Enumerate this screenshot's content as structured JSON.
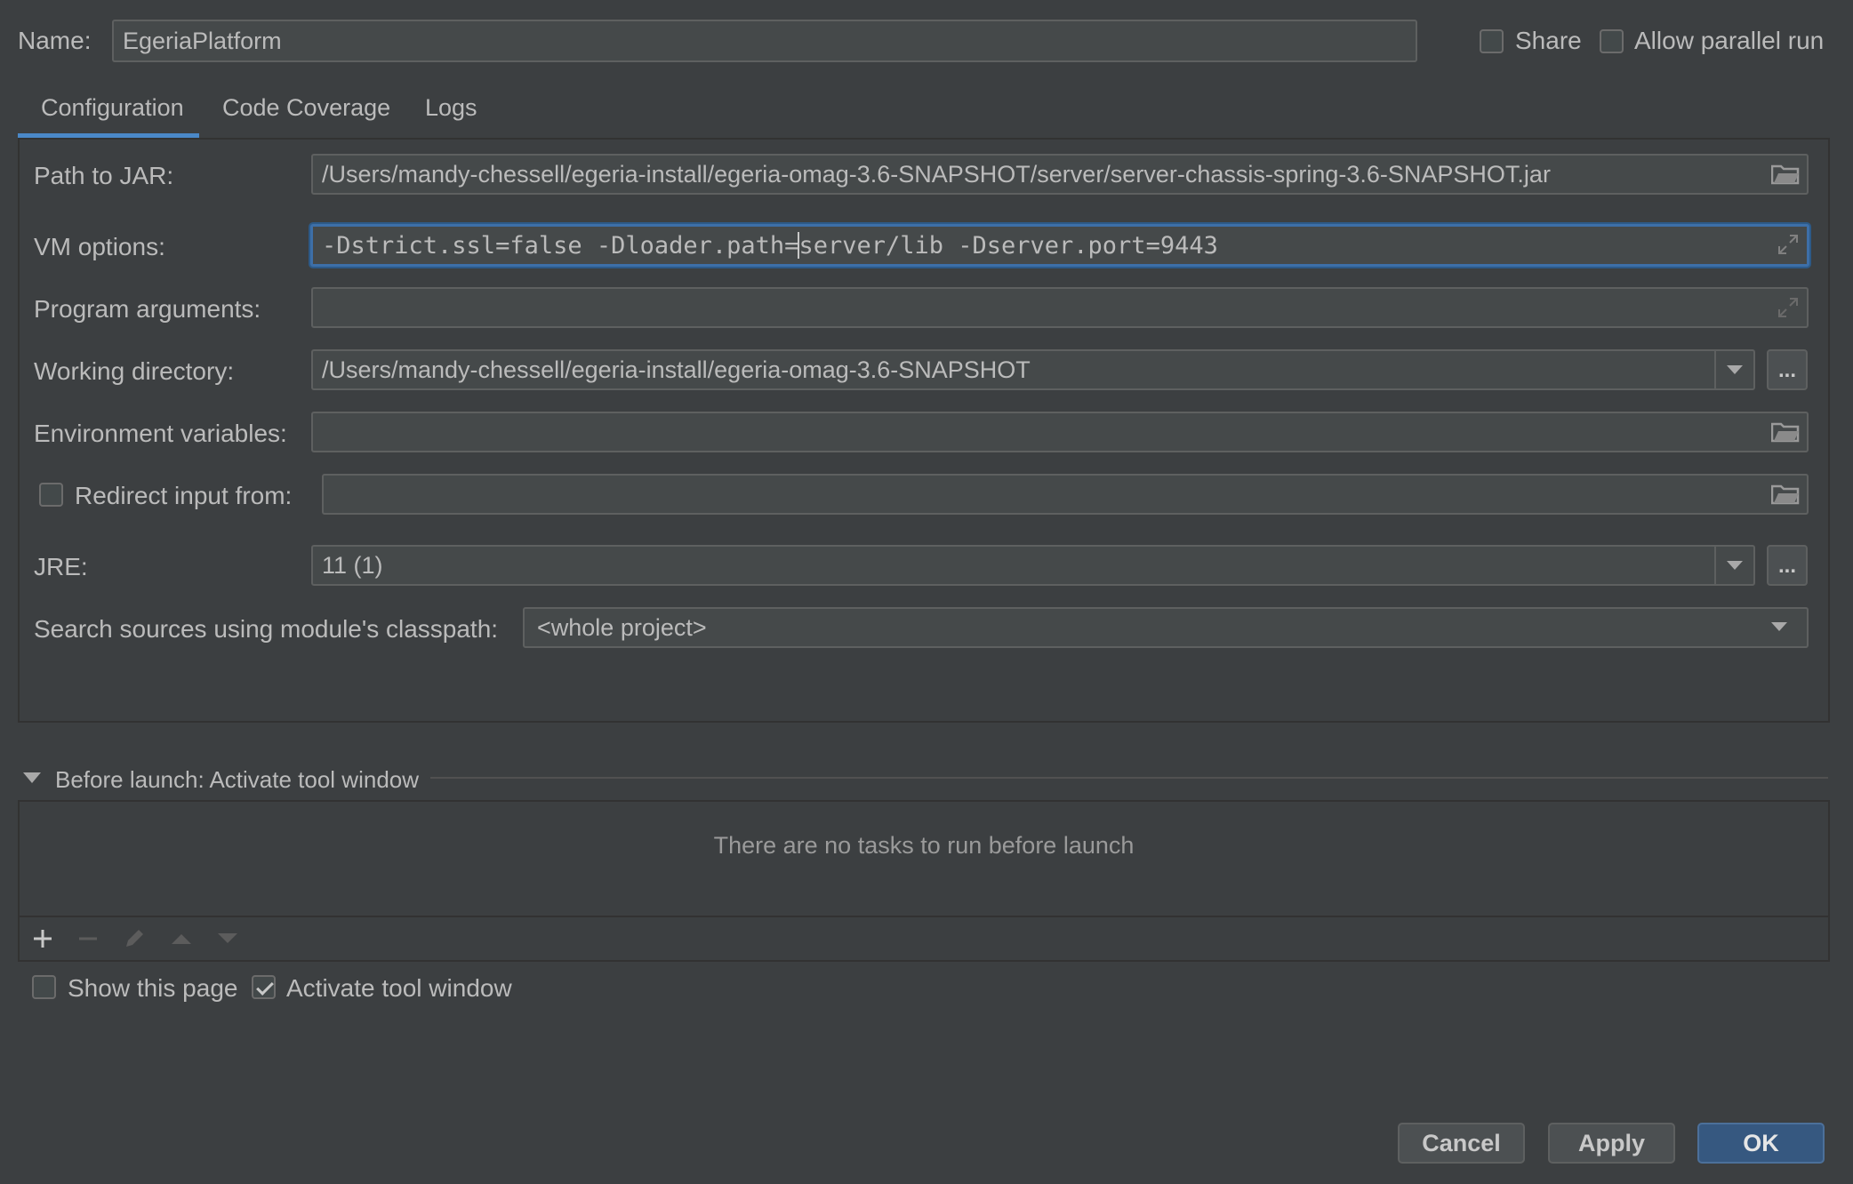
{
  "header": {
    "name_label": "Name:",
    "name_value": "EgeriaPlatform",
    "share_label": "Share",
    "share_checked": false,
    "parallel_label": "Allow parallel run",
    "parallel_checked": false
  },
  "tabs": [
    {
      "label": "Configuration",
      "active": true
    },
    {
      "label": "Code Coverage",
      "active": false
    },
    {
      "label": "Logs",
      "active": false
    }
  ],
  "config": {
    "jar_label": "Path to JAR:",
    "jar_value": "/Users/mandy-chessell/egeria-install/egeria-omag-3.6-SNAPSHOT/server/server-chassis-spring-3.6-SNAPSHOT.jar",
    "vm_label": "VM options:",
    "vm_value_before_caret": "-Dstrict.ssl=false -Dloader.path=",
    "vm_value_after_caret": "server/lib -Dserver.port=9443",
    "args_label": "Program arguments:",
    "args_value": "",
    "workdir_label": "Working directory:",
    "workdir_value": "/Users/mandy-chessell/egeria-install/egeria-omag-3.6-SNAPSHOT",
    "env_label": "Environment variables:",
    "env_value": "",
    "redirect_label": "Redirect input from:",
    "redirect_checked": false,
    "redirect_value": "",
    "jre_label": "JRE:",
    "jre_value": "11 (1)",
    "classpath_label": "Search sources using module's classpath:",
    "classpath_value": "<whole project>",
    "ellipsis": "..."
  },
  "before_launch": {
    "title": "Before launch: Activate tool window",
    "empty_text": "There are no tasks to run before launch",
    "show_page_label": "Show this page",
    "show_page_checked": false,
    "activate_label": "Activate tool window",
    "activate_checked": true
  },
  "footer": {
    "cancel": "Cancel",
    "apply": "Apply",
    "ok": "OK"
  },
  "colors": {
    "background": "#3c3f41",
    "field": "#45494a",
    "focus": "#3d6fa8",
    "tab_underline": "#4a88c7",
    "primary_button": "#365880"
  },
  "icons": {
    "folder": "folder-icon",
    "expand": "expand-icon",
    "add": "plus-icon",
    "remove": "minus-icon",
    "edit": "pencil-icon",
    "move_up": "arrow-up-icon",
    "move_down": "arrow-down-icon"
  }
}
